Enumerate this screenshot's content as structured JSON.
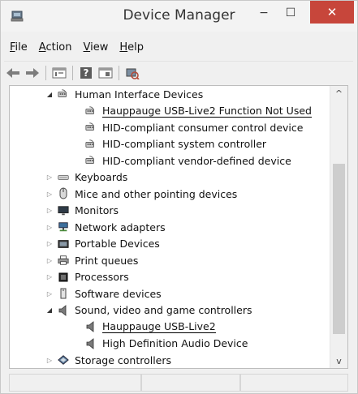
{
  "window": {
    "title": "Device Manager",
    "minimize_glyph": "−",
    "maximize_glyph": "☐",
    "close_glyph": "✕"
  },
  "menu": [
    {
      "accel": "F",
      "rest": "ile"
    },
    {
      "accel": "A",
      "rest": "ction"
    },
    {
      "accel": "V",
      "rest": "iew"
    },
    {
      "accel": "H",
      "rest": "elp"
    }
  ],
  "toolbar": {
    "back_icon": "back-arrow-icon",
    "forward_icon": "forward-arrow-icon",
    "properties_icon": "properties-icon",
    "help_icon": "help-icon",
    "view_icon": "view-icon",
    "scan_icon": "scan-hardware-icon",
    "help_glyph": "?"
  },
  "tree": {
    "nodes": [
      {
        "label": "Human Interface Devices",
        "level": 1,
        "expanded": true,
        "icon": "hid-icon"
      },
      {
        "label": "Hauppauge USB-Live2 Function Not Used",
        "level": 2,
        "icon": "hid-icon",
        "underlined": true
      },
      {
        "label": "HID-compliant consumer control device",
        "level": 2,
        "icon": "hid-icon"
      },
      {
        "label": "HID-compliant system controller",
        "level": 2,
        "icon": "hid-icon"
      },
      {
        "label": "HID-compliant vendor-defined device",
        "level": 2,
        "icon": "hid-icon"
      },
      {
        "label": "Keyboards",
        "level": 1,
        "expanded": false,
        "icon": "keyboard-icon"
      },
      {
        "label": "Mice and other pointing devices",
        "level": 1,
        "expanded": false,
        "icon": "mouse-icon"
      },
      {
        "label": "Monitors",
        "level": 1,
        "expanded": false,
        "icon": "monitor-icon"
      },
      {
        "label": "Network adapters",
        "level": 1,
        "expanded": false,
        "icon": "network-icon"
      },
      {
        "label": "Portable Devices",
        "level": 1,
        "expanded": false,
        "icon": "portable-device-icon"
      },
      {
        "label": "Print queues",
        "level": 1,
        "expanded": false,
        "icon": "printer-icon"
      },
      {
        "label": "Processors",
        "level": 1,
        "expanded": false,
        "icon": "processor-icon"
      },
      {
        "label": "Software devices",
        "level": 1,
        "expanded": false,
        "icon": "software-device-icon"
      },
      {
        "label": "Sound, video and game controllers",
        "level": 1,
        "expanded": true,
        "icon": "speaker-icon"
      },
      {
        "label": "Hauppauge USB-Live2",
        "level": 2,
        "icon": "speaker-icon",
        "underlined": true
      },
      {
        "label": "High Definition Audio Device",
        "level": 2,
        "icon": "speaker-icon"
      },
      {
        "label": "Storage controllers",
        "level": 1,
        "expanded": false,
        "icon": "storage-icon"
      }
    ]
  },
  "scrollbar": {
    "up_glyph": "^",
    "down_glyph": "v"
  },
  "colors": {
    "close_button": "#c7463b",
    "selection_underline": "#000000"
  }
}
